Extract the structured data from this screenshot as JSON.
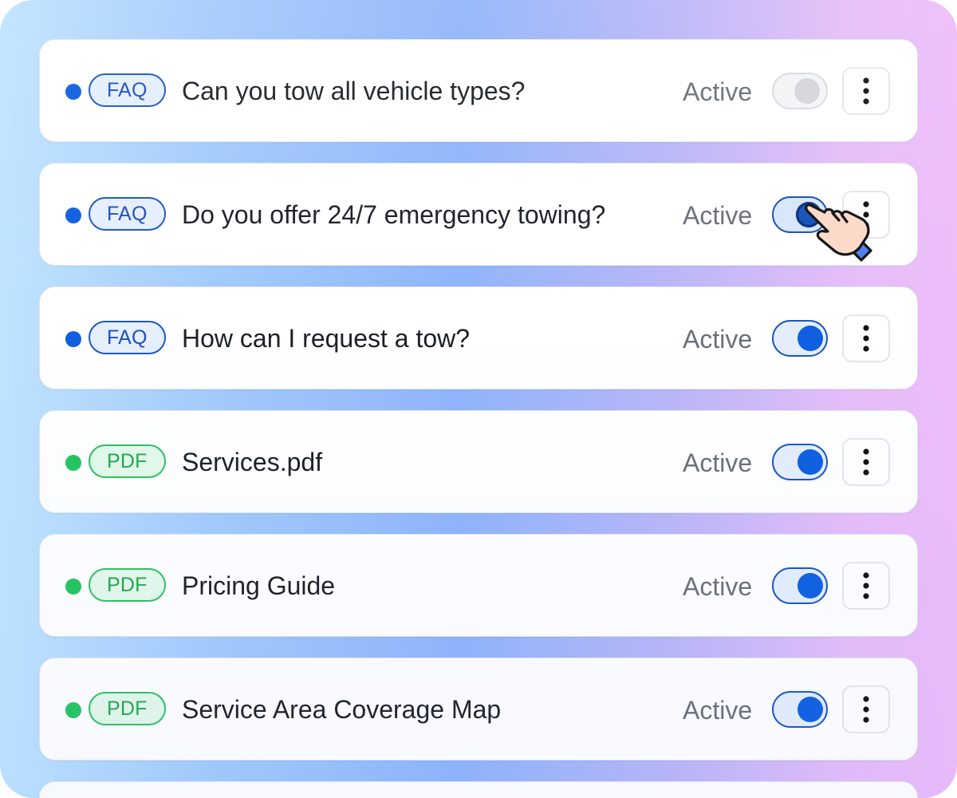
{
  "rows": [
    {
      "type": "FAQ",
      "title": "Can you tow all vehicle types?",
      "status": "Active",
      "enabled": false
    },
    {
      "type": "FAQ",
      "title": "Do you offer 24/7 emergency towing?",
      "status": "Active",
      "enabled": true
    },
    {
      "type": "FAQ",
      "title": "How can I request a tow?",
      "status": "Active",
      "enabled": true
    },
    {
      "type": "PDF",
      "title": "Services.pdf",
      "status": "Active",
      "enabled": true
    },
    {
      "type": "PDF",
      "title": "Pricing Guide",
      "status": "Active",
      "enabled": true
    },
    {
      "type": "PDF",
      "title": "Service Area Coverage Map",
      "status": "Active",
      "enabled": true
    }
  ],
  "colors": {
    "faq_dot": "#0f5fe0",
    "pdf_dot": "#22c55e",
    "toggle_on": "#0f5fe0",
    "toggle_off": "#d4d6db"
  },
  "icons": {
    "more": "more-vertical-icon",
    "cursor": "hand-pointer-icon"
  }
}
